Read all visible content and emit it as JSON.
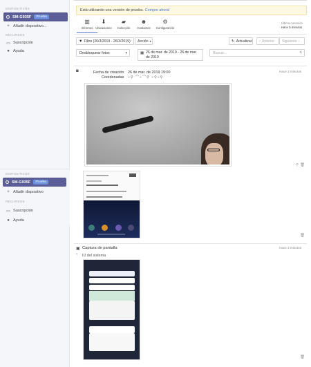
{
  "sidebar": {
    "top": {
      "devices_header": "DISPOSITIVOS",
      "device_name": "SM-G935F",
      "device_badge": "Prueba",
      "add_device": "Añadir dispositivo...",
      "resources_header": "RECURSOS",
      "subscription": "Suscripción",
      "help": "Ayuda"
    },
    "bottom": {
      "devices_header": "DISPOSITIVOS",
      "device_name": "SM-G935F",
      "device_badge": "Prueba",
      "add_device": "Añadir dispositivo",
      "resources_header": "RECURSOS",
      "subscription": "Suscripción",
      "help": "Ayuda"
    }
  },
  "trial_banner": {
    "text": "Está utilizando una versión de prueba.",
    "link": "Compre ahora!"
  },
  "toolbar": {
    "items": [
      {
        "label": "Informes",
        "icon": "bar-chart-icon"
      },
      {
        "label": "Ubicaciones",
        "icon": "download-icon"
      },
      {
        "label": "Colección",
        "icon": "folder-icon"
      },
      {
        "label": "Contactos",
        "icon": "people-icon"
      },
      {
        "label": "Configuración",
        "icon": "gears-icon"
      }
    ],
    "last_connection_label": "Última conexión",
    "last_connection_value": "Hace 5 minutos"
  },
  "filters": {
    "filter_label": "Filtro (26/3/2019 - 26/3/2019)",
    "action_label": "Acción",
    "refresh_label": "Actualizar",
    "prev_label": "Anterior",
    "next_label": "Siguiente",
    "type_select": "Desbloquear fotos",
    "date_range": "26 de mar. de 2019 - 26 de mar. de 2019",
    "search_placeholder": "Buscar..."
  },
  "feed": {
    "card1": {
      "ago": "Hace 2 minutos",
      "creation_label": "Fecha de creación",
      "creation_value": "26 de mar. de 2019 19:00",
      "coords_label": "Coordenadas"
    },
    "card2": {
      "title": "Captura de pantalla",
      "ago": "Hace 2 minutos",
      "subtitle": "IU del sistema"
    }
  }
}
